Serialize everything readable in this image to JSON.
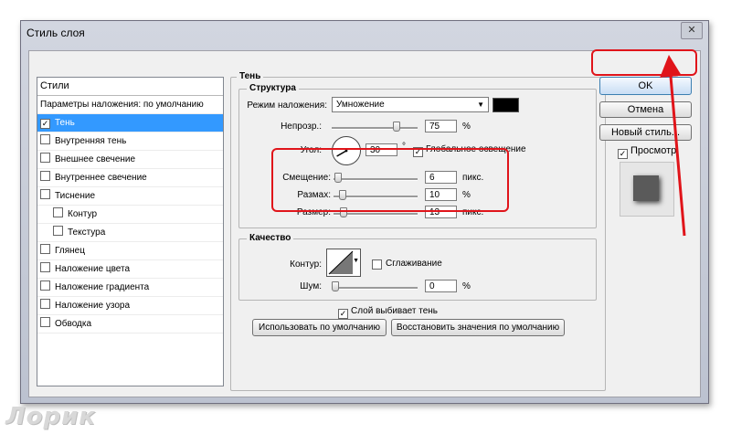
{
  "window": {
    "title": "Стиль слоя",
    "close_glyph": "✕"
  },
  "styles_panel": {
    "header": "Стили",
    "items": [
      {
        "label": "Параметры наложения: по умолчанию",
        "checkbox": false,
        "checked": false,
        "selected": false,
        "indent": false
      },
      {
        "label": "Тень",
        "checkbox": true,
        "checked": true,
        "selected": true,
        "indent": false
      },
      {
        "label": "Внутренняя тень",
        "checkbox": true,
        "checked": false,
        "selected": false,
        "indent": false
      },
      {
        "label": "Внешнее свечение",
        "checkbox": true,
        "checked": false,
        "selected": false,
        "indent": false
      },
      {
        "label": "Внутреннее свечение",
        "checkbox": true,
        "checked": false,
        "selected": false,
        "indent": false
      },
      {
        "label": "Тиснение",
        "checkbox": true,
        "checked": false,
        "selected": false,
        "indent": false
      },
      {
        "label": "Контур",
        "checkbox": true,
        "checked": false,
        "selected": false,
        "indent": true
      },
      {
        "label": "Текстура",
        "checkbox": true,
        "checked": false,
        "selected": false,
        "indent": true
      },
      {
        "label": "Глянец",
        "checkbox": true,
        "checked": false,
        "selected": false,
        "indent": false
      },
      {
        "label": "Наложение цвета",
        "checkbox": true,
        "checked": false,
        "selected": false,
        "indent": false
      },
      {
        "label": "Наложение градиента",
        "checkbox": true,
        "checked": false,
        "selected": false,
        "indent": false
      },
      {
        "label": "Наложение узора",
        "checkbox": true,
        "checked": false,
        "selected": false,
        "indent": false
      },
      {
        "label": "Обводка",
        "checkbox": true,
        "checked": false,
        "selected": false,
        "indent": false
      }
    ]
  },
  "shadow": {
    "title": "Тень",
    "structure": {
      "title": "Структура",
      "blend_mode_label": "Режим наложения:",
      "blend_mode_value": "Умножение",
      "color": "#000000",
      "opacity_label": "Непрозр.:",
      "opacity_value": "75",
      "opacity_unit": "%",
      "opacity_level": 0.75,
      "angle_label": "Угол:",
      "angle_value": "30",
      "angle_unit": "°",
      "global_light_label": "Глобальное освещение",
      "global_light_checked": true,
      "distance_label": "Смещение:",
      "distance_value": "6",
      "distance_unit": "пикс.",
      "spread_label": "Размах:",
      "spread_value": "10",
      "spread_unit": "%",
      "size_label": "Размер:",
      "size_value": "13",
      "size_unit": "пикс."
    },
    "quality": {
      "title": "Качество",
      "contour_label": "Контур:",
      "antialias_label": "Сглаживание",
      "antialias_checked": false,
      "noise_label": "Шум:",
      "noise_value": "0",
      "noise_unit": "%"
    },
    "knockout_label": "Слой выбивает тень",
    "knockout_checked": true,
    "make_default_label": "Использовать по умолчанию",
    "reset_default_label": "Восстановить значения по умолчанию"
  },
  "buttons": {
    "ok": "OK",
    "cancel": "Отмена",
    "new_style": "Новый стиль...",
    "preview_label": "Просмотр",
    "preview_checked": true
  },
  "annotations": {
    "highlight_color": "#e0141a"
  },
  "watermark": "Лорик"
}
